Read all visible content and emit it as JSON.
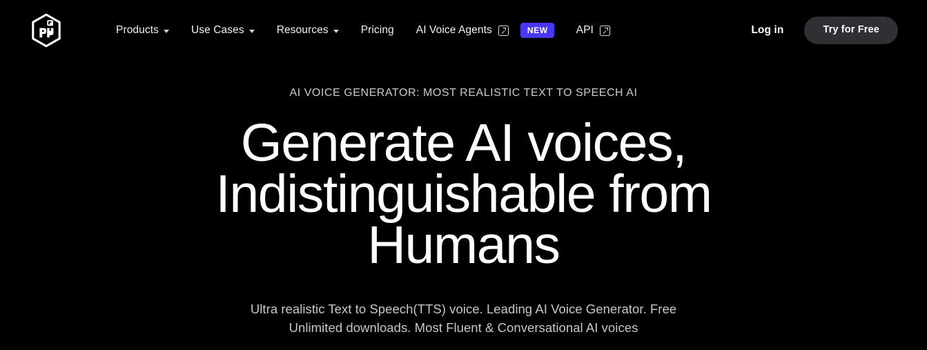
{
  "colors": {
    "background": "#000000",
    "text_primary": "#ffffff",
    "text_muted": "#c6c6cd",
    "badge_new": "#4a37f2",
    "cta_button": "#2f2f34"
  },
  "header": {
    "logo": {
      "icon": "hexagon-cube-logo-icon",
      "alt": "PlayHT cube logo"
    },
    "nav_items": [
      {
        "label": "Products",
        "has_dropdown": true,
        "external": false,
        "badge": null
      },
      {
        "label": "Use Cases",
        "has_dropdown": true,
        "external": false,
        "badge": null
      },
      {
        "label": "Resources",
        "has_dropdown": true,
        "external": false,
        "badge": null
      },
      {
        "label": "Pricing",
        "has_dropdown": false,
        "external": false,
        "badge": null
      },
      {
        "label": "AI Voice Agents",
        "has_dropdown": false,
        "external": true,
        "badge": "NEW"
      },
      {
        "label": "API",
        "has_dropdown": false,
        "external": true,
        "badge": null
      }
    ],
    "login_label": "Log in",
    "cta_label": "Try for Free"
  },
  "hero": {
    "eyebrow": "AI VOICE GENERATOR: MOST REALISTIC TEXT TO SPEECH AI",
    "title": "Generate AI voices, Indistinguishable from Humans",
    "subtitle": "Ultra realistic Text to Speech(TTS) voice. Leading AI Voice Generator. Free Unlimited downloads. Most Fluent & Conversational AI voices"
  }
}
